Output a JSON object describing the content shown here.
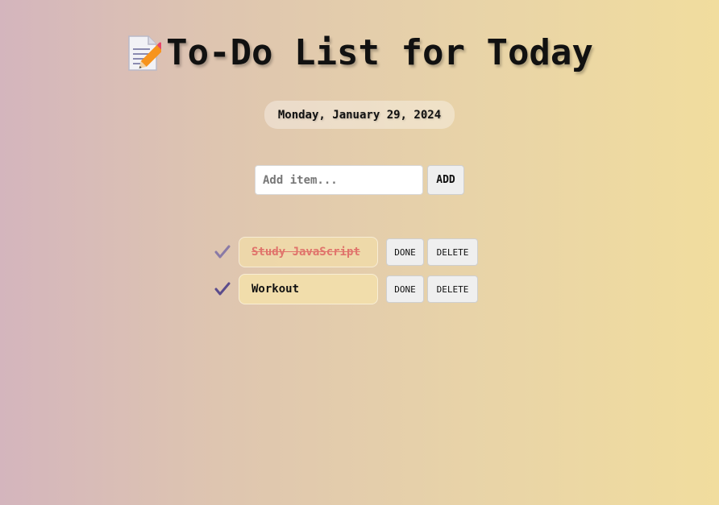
{
  "header": {
    "title": "To-Do List for Today",
    "icon": "memo-icon"
  },
  "date_text": "Monday, January 29, 2024",
  "add_form": {
    "placeholder": "Add item...",
    "value": "",
    "button_label": "ADD"
  },
  "todos": [
    {
      "text": "Study JavaScript",
      "completed": true,
      "check_icon": "checkmark-icon",
      "done_label": "DONE",
      "delete_label": "DELETE"
    },
    {
      "text": "Workout",
      "completed": false,
      "check_icon": "checkmark-icon",
      "done_label": "DONE",
      "delete_label": "DELETE"
    }
  ],
  "colors": {
    "background_start": "#d4b5bd",
    "background_end": "#f1dd9e",
    "completed_text": "#e0736b",
    "check_faded": "#8a7aa6",
    "check_strong": "#5b4c8c"
  }
}
